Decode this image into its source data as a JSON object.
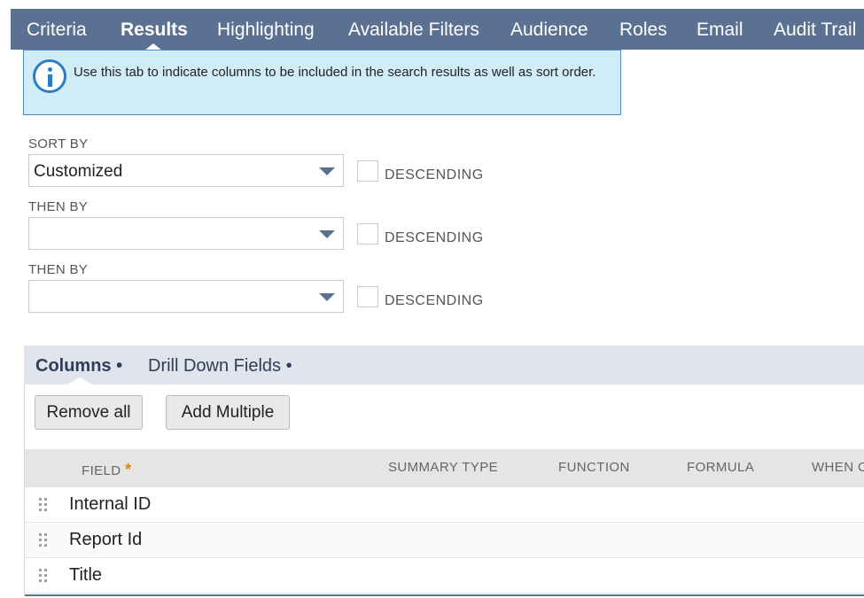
{
  "tabs": [
    {
      "label": "Criteria"
    },
    {
      "label": "Results"
    },
    {
      "label": "Highlighting"
    },
    {
      "label": "Available Filters"
    },
    {
      "label": "Audience"
    },
    {
      "label": "Roles"
    },
    {
      "label": "Email"
    },
    {
      "label": "Audit Trail"
    }
  ],
  "active_tab": "Results",
  "info": {
    "text": "Use this tab to indicate columns to be included in the search results as well as sort order."
  },
  "sort": {
    "sort_by_label": "SORT BY",
    "sort_by_value": "Customized",
    "then_by_label_1": "THEN BY",
    "then_by_value_1": "",
    "then_by_label_2": "THEN BY",
    "then_by_value_2": "",
    "descending_label": "DESCENDING"
  },
  "subtabs": [
    {
      "label": "Columns •"
    },
    {
      "label": "Drill Down Fields •"
    }
  ],
  "buttons": {
    "remove_all": "Remove all",
    "add_multiple": "Add Multiple"
  },
  "grid": {
    "headers": [
      "FIELD",
      "SUMMARY TYPE",
      "FUNCTION",
      "FORMULA",
      "WHEN O"
    ],
    "required_mark": "*",
    "rows": [
      "Internal ID",
      "Report Id",
      "Title"
    ]
  },
  "colors": {
    "tab_bar": "#5a7191",
    "info_bg": "#d0ecf7",
    "info_icon": "#2b7cc6",
    "subtab_bar": "#dfe4ed",
    "required": "#d88b00"
  },
  "icons": [
    "info-icon",
    "dropdown-arrow-icon",
    "drag-handle-icon"
  ]
}
